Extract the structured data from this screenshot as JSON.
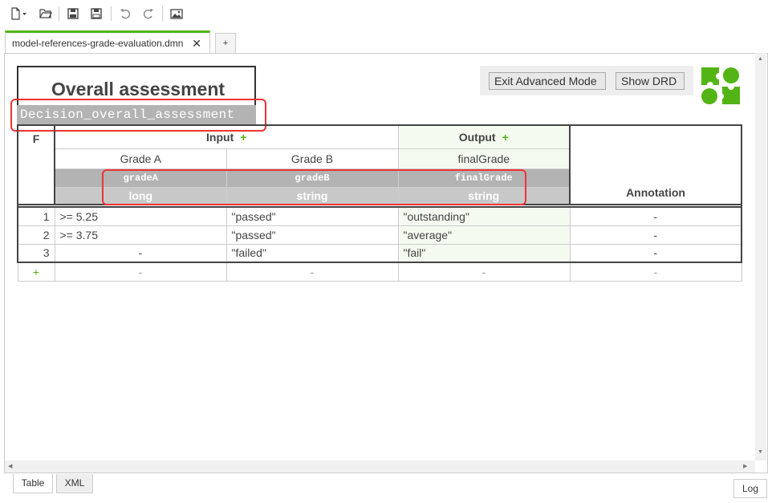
{
  "toolbar": {
    "icons": [
      "new-file-icon",
      "open-folder-icon",
      "save-icon",
      "save-as-icon",
      "undo-icon",
      "redo-icon",
      "export-image-icon"
    ]
  },
  "tabs": {
    "active_label": "model-references-grade-evaluation.dmn",
    "close": "✕",
    "add": "+"
  },
  "decision": {
    "title": "Overall assessment",
    "id": "Decision_overall_assessment"
  },
  "actions": {
    "exit_advanced": "Exit Advanced Mode",
    "show_drd": "Show DRD"
  },
  "table": {
    "hit_policy": "F",
    "input_header": "Input",
    "output_header": "Output",
    "plus": "+",
    "annotation_header": "Annotation",
    "columns": [
      {
        "label": "Grade A",
        "expression": "gradeA",
        "type": "long"
      },
      {
        "label": "Grade B",
        "expression": "gradeB",
        "type": "string"
      },
      {
        "label": "finalGrade",
        "expression": "finalGrade",
        "type": "string"
      }
    ],
    "rows": [
      {
        "num": "1",
        "a": ">= 5.25",
        "b": "\"passed\"",
        "out": "\"outstanding\"",
        "ann": "-"
      },
      {
        "num": "2",
        "a": ">= 3.75",
        "b": "\"passed\"",
        "out": "\"average\"",
        "ann": "-"
      },
      {
        "num": "3",
        "a": "-",
        "b": "\"failed\"",
        "out": "\"fail\"",
        "ann": "-"
      }
    ],
    "add_row": {
      "plus": "+",
      "a": "-",
      "b": "-",
      "out": "-",
      "ann": "-"
    }
  },
  "bottom": {
    "tab_table": "Table",
    "tab_xml": "XML",
    "log": "Log"
  },
  "colors": {
    "accent": "#52b415",
    "highlight": "#e33333",
    "header_gray": "#b3b3b3"
  }
}
